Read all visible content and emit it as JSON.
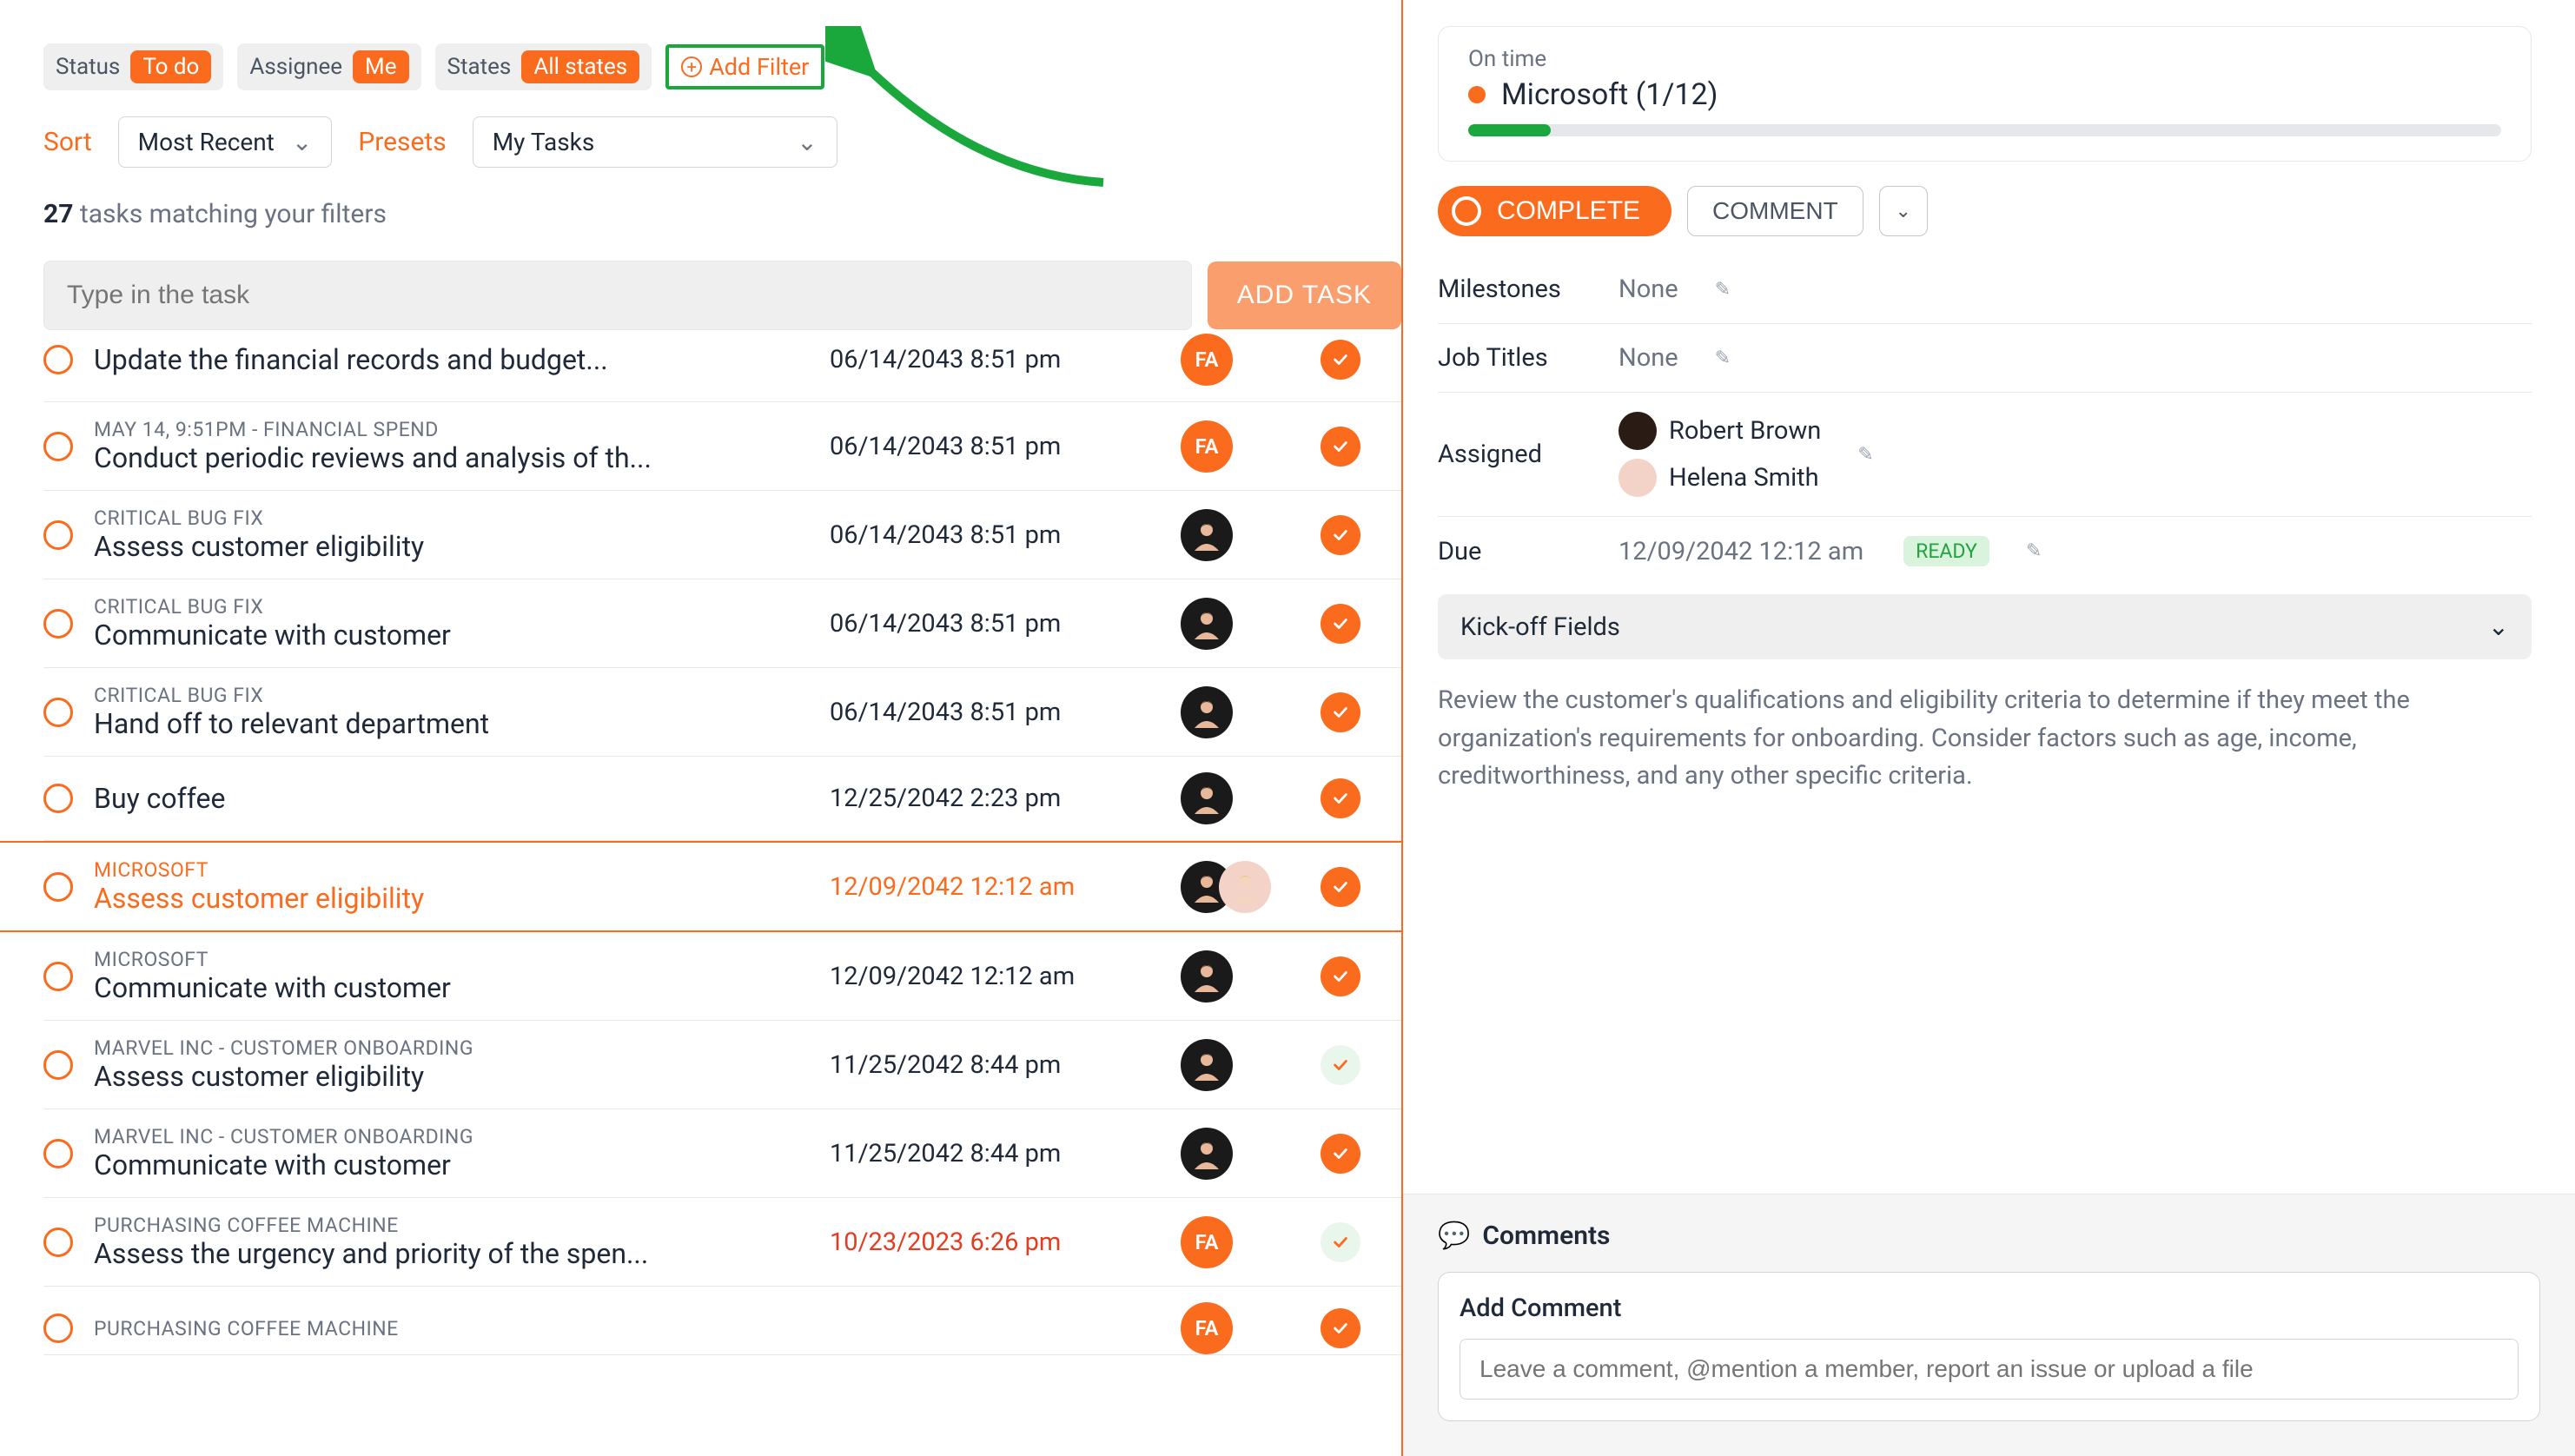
{
  "filters": {
    "status_label": "Status",
    "status_value": "To do",
    "assignee_label": "Assignee",
    "assignee_value": "Me",
    "states_label": "States",
    "states_value": "All states",
    "add_filter": "Add Filter"
  },
  "sort": {
    "label": "Sort",
    "value": "Most Recent",
    "presets_label": "Presets",
    "presets_value": "My Tasks"
  },
  "count": {
    "num": "27",
    "suffix": "tasks matching your filters"
  },
  "add_task": {
    "placeholder": "Type in the task",
    "button": "ADD TASK"
  },
  "tasks": [
    {
      "context": "",
      "title": "Update the financial records and budget...",
      "date": "06/14/2043 8:51 pm",
      "dateclass": "",
      "avatar": "fa",
      "check": "solid",
      "partial": true
    },
    {
      "context": "MAY 14, 9:51PM - FINANCIAL SPEND",
      "title": "Conduct periodic reviews and analysis of th...",
      "date": "06/14/2043 8:51 pm",
      "dateclass": "",
      "avatar": "fa",
      "check": "solid"
    },
    {
      "context": "CRITICAL BUG FIX",
      "title": "Assess customer eligibility",
      "date": "06/14/2043 8:51 pm",
      "dateclass": "",
      "avatar": "dark",
      "check": "solid"
    },
    {
      "context": "CRITICAL BUG FIX",
      "title": "Communicate with customer",
      "date": "06/14/2043 8:51 pm",
      "dateclass": "",
      "avatar": "dark",
      "check": "solid"
    },
    {
      "context": "CRITICAL BUG FIX",
      "title": "Hand off to relevant department",
      "date": "06/14/2043 8:51 pm",
      "dateclass": "",
      "avatar": "dark",
      "check": "solid"
    },
    {
      "context": "",
      "title": "Buy coffee",
      "date": "12/25/2042 2:23 pm",
      "dateclass": "",
      "avatar": "dark",
      "check": "solid"
    },
    {
      "context": "MICROSOFT",
      "title": "Assess customer eligibility",
      "date": "12/09/2042 12:12 am",
      "dateclass": "orange",
      "avatar": "twin",
      "check": "solid",
      "selected": true
    },
    {
      "context": "MICROSOFT",
      "title": "Communicate with customer",
      "date": "12/09/2042 12:12 am",
      "dateclass": "",
      "avatar": "dark",
      "check": "solid"
    },
    {
      "context": "MARVEL INC - CUSTOMER ONBOARDING",
      "title": "Assess customer eligibility",
      "date": "11/25/2042 8:44 pm",
      "dateclass": "",
      "avatar": "dark",
      "check": "outline"
    },
    {
      "context": "MARVEL INC - CUSTOMER ONBOARDING",
      "title": "Communicate with customer",
      "date": "11/25/2042 8:44 pm",
      "dateclass": "",
      "avatar": "dark",
      "check": "solid"
    },
    {
      "context": "PURCHASING COFFEE MACHINE",
      "title": "Assess the urgency and priority of the spen...",
      "date": "10/23/2023 6:26 pm",
      "dateclass": "red",
      "avatar": "fa",
      "check": "outline"
    },
    {
      "context": "PURCHASING COFFEE MACHINE",
      "title": "",
      "date": "",
      "dateclass": "",
      "avatar": "fa",
      "check": "solid",
      "cut": true
    }
  ],
  "detail": {
    "ontime_label": "On time",
    "project": "Microsoft (1/12)",
    "progress_pct": 8,
    "complete_btn": "COMPLETE",
    "comment_btn": "COMMENT",
    "milestones_label": "Milestones",
    "milestones_value": "None",
    "jobtitles_label": "Job Titles",
    "jobtitles_value": "None",
    "assigned_label": "Assigned",
    "assigned": [
      "Robert Brown",
      "Helena Smith"
    ],
    "due_label": "Due",
    "due_value": "12/09/2042 12:12 am",
    "ready_pill": "READY",
    "kickoff_label": "Kick-off Fields",
    "description": "Review the customer's qualifications and eligibility criteria to determine if they meet the organization's requirements for onboarding. Consider factors such as age, income, creditworthiness, and any other specific criteria.",
    "comments_title": "Comments",
    "add_comment_label": "Add Comment",
    "comment_placeholder": "Leave a comment, @mention a member, report an issue or upload a file"
  },
  "colors": {
    "accent": "#fb6b1e",
    "green": "#1aa73c"
  }
}
